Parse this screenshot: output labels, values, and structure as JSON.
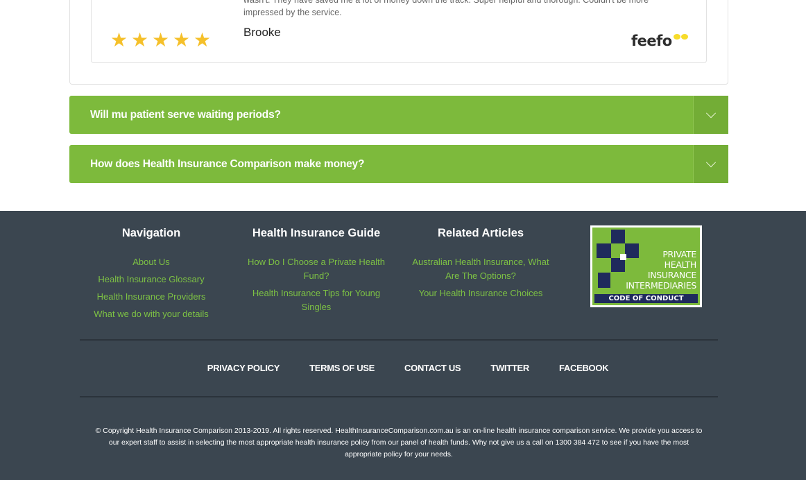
{
  "review": {
    "text": "wasn't. They have saved me a lot of money down the track. Super helpful and thorough. Couldn't be more impressed by the service.",
    "author": "Brooke",
    "rating": 5,
    "stars": [
      "★",
      "★",
      "★",
      "★",
      "★"
    ],
    "provider_logo": "feefo",
    "star_color": "#f5c02a"
  },
  "faq": [
    {
      "question": "Will mu patient serve waiting periods?"
    },
    {
      "question": "How does Health Insurance Comparison make money?"
    }
  ],
  "footer": {
    "columns": [
      {
        "title": "Navigation",
        "links": [
          "About Us",
          "Health Insurance Glossary",
          "Health Insurance Providers",
          "What we do with your details"
        ]
      },
      {
        "title": "Health Insurance Guide",
        "links": [
          "How Do I Choose a Private Health Fund?",
          "Health Insurance Tips for Young Singles"
        ]
      },
      {
        "title": "Related Articles",
        "links": [
          "Australian Health Insurance, What Are The Options?",
          "Your Health Insurance Choices"
        ]
      }
    ],
    "badge": {
      "lines": [
        "PRIVATE",
        "HEALTH",
        "INSURANCE",
        "INTERMEDIARIES"
      ],
      "bar": "CODE OF CONDUCT"
    },
    "bottom_links": [
      "PRIVACY POLICY",
      "TERMS OF USE",
      "CONTACT US",
      "TWITTER",
      "FACEBOOK"
    ],
    "copyright": "© Copyright Health Insurance Comparison 2013-2019. All rights reserved. HealthInsuranceComparison.com.au is an on-line health insurance comparison service. We provide you access to our expert staff to assist in selecting the most appropriate health insurance policy from our panel of health funds. Why not give us a call on 1300 384 472 to see if you have the most appropriate policy for your needs."
  },
  "colors": {
    "accent_green": "#7dba3c",
    "footer_bg": "#3b4650",
    "footer_link": "#7dc144"
  }
}
